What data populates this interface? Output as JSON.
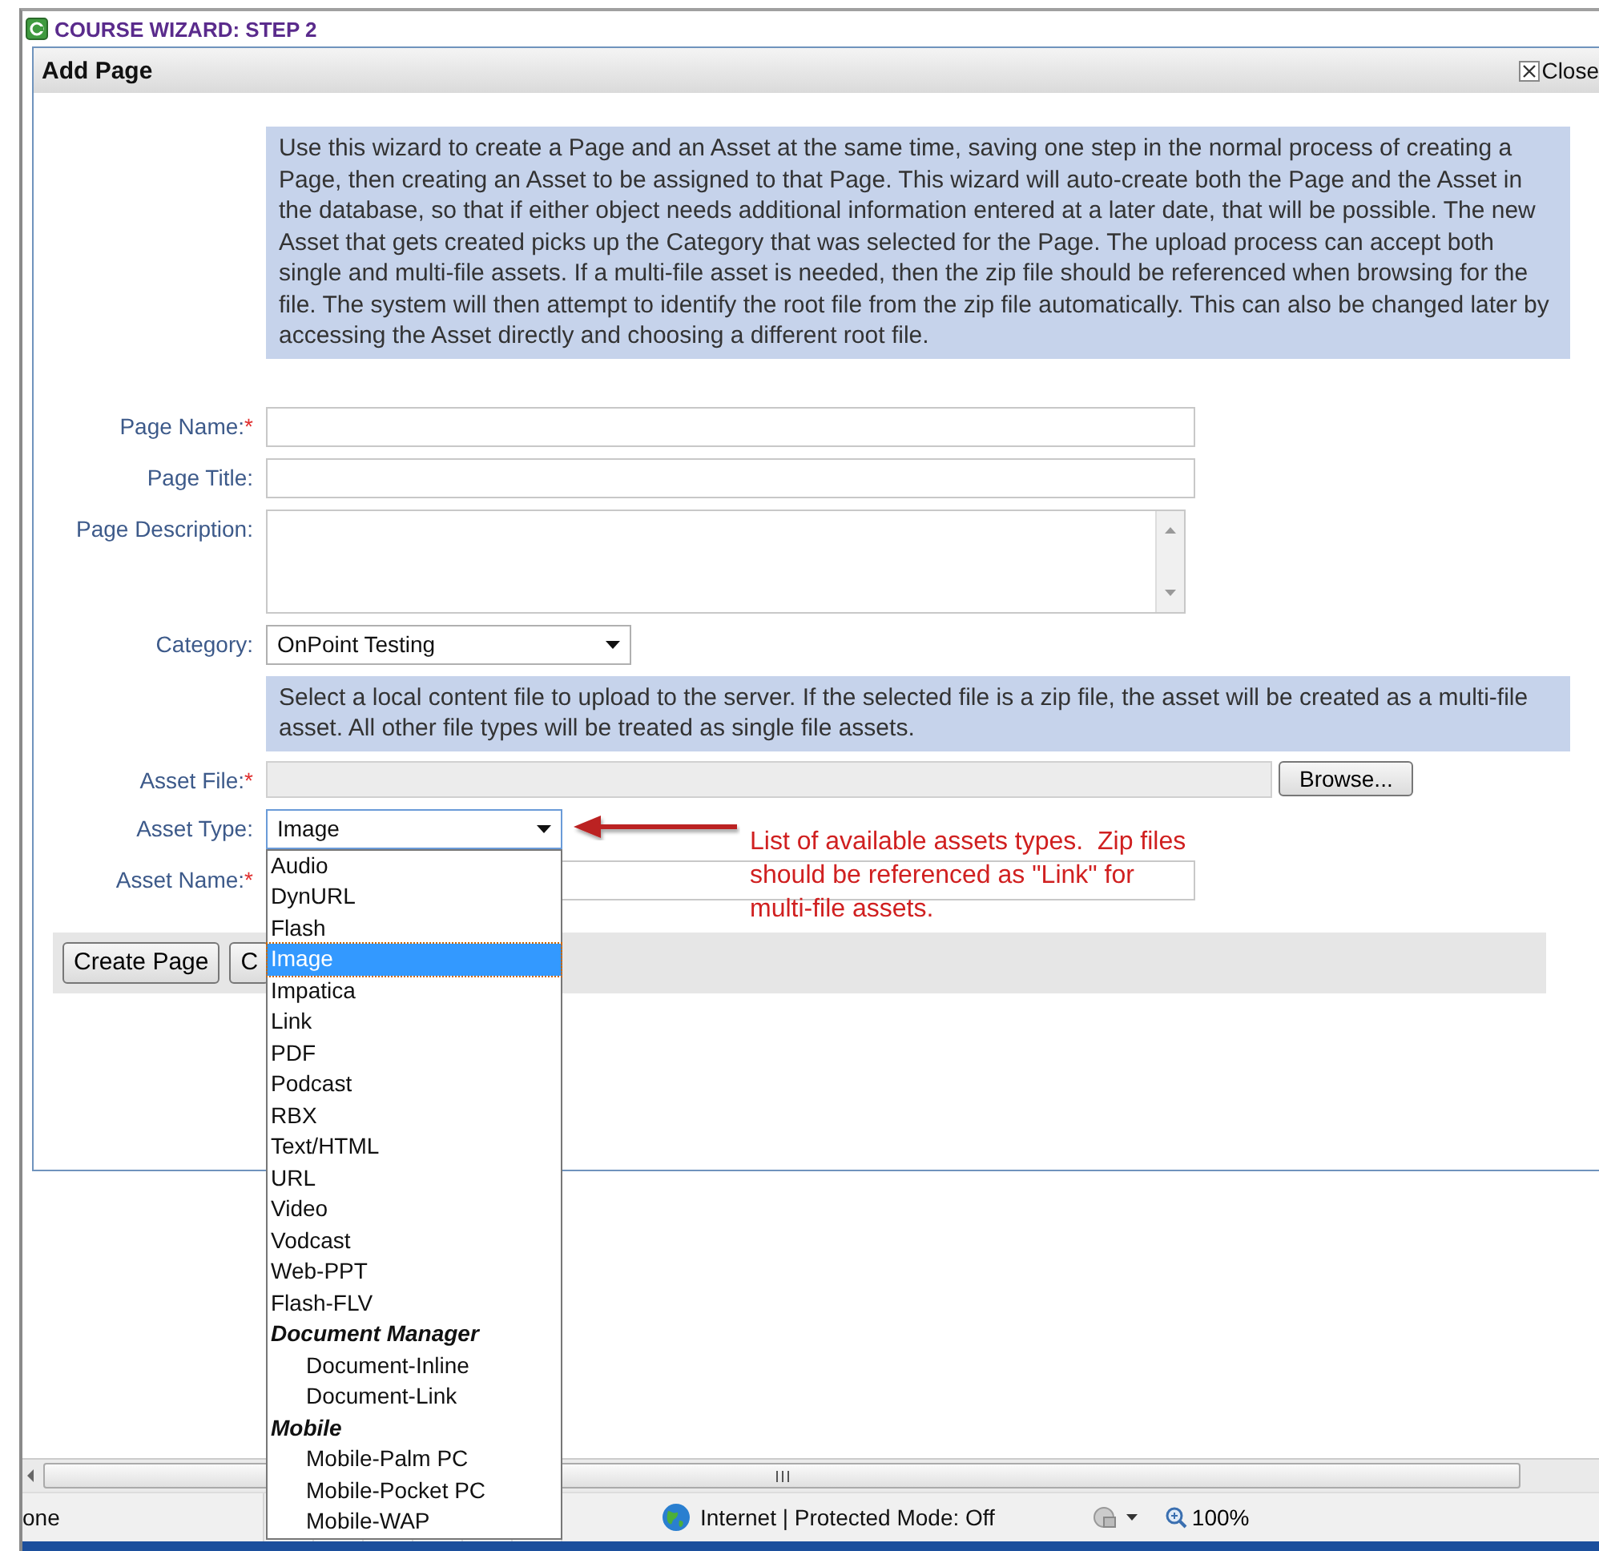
{
  "window": {
    "title": "COURSE WIZARD: STEP 2"
  },
  "dialog": {
    "title": "Add Page",
    "close": "Close"
  },
  "intro": "Use this wizard to create a Page and an Asset at the same time, saving one step in the normal process of creating a Page, then creating an Asset to be assigned to that Page. This wizard will auto-create both the Page and the Asset in the database, so that if either object needs additional information entered at a later date, that will be possible. The new Asset that gets created picks up the Category that was selected for the Page. The upload process can accept both single and multi-file assets. If a multi-file asset is needed, then the zip file should be referenced when browsing for the file. The system will then attempt to identify the root file from the zip file automatically. This can also be changed later by accessing the Asset directly and choosing a different root file.",
  "fields": [
    {
      "kind": "text",
      "label": "Page Name:",
      "marker": "*"
    },
    {
      "kind": "text",
      "label": "Page Title:"
    },
    {
      "kind": "textarea",
      "label": "Page Description:"
    },
    {
      "kind": "select",
      "label": "Category:",
      "value": "OnPoint Testing"
    }
  ],
  "upload_note": "Select a local content file to upload to the server. If the selected file is a zip file, the asset will be created as a multi-file asset. All other file types will be treated as single file assets.",
  "asset_file": {
    "label": "Asset File:",
    "marker": "*",
    "button": "Browse..."
  },
  "asset_type": {
    "label": "Asset Type:",
    "value": "Image",
    "expanded": true,
    "options": [
      {
        "kind": "option",
        "label": "Audio",
        "selected": false
      },
      {
        "kind": "option",
        "label": "DynURL",
        "selected": false
      },
      {
        "kind": "option",
        "label": "Flash",
        "selected": false
      },
      {
        "kind": "option",
        "label": "Image",
        "selected": true
      },
      {
        "kind": "option",
        "label": "Impatica",
        "selected": false
      },
      {
        "kind": "option",
        "label": "Link",
        "selected": false
      },
      {
        "kind": "option",
        "label": "PDF",
        "selected": false
      },
      {
        "kind": "option",
        "label": "Podcast",
        "selected": false
      },
      {
        "kind": "option",
        "label": "RBX",
        "selected": false
      },
      {
        "kind": "option",
        "label": "Text/HTML",
        "selected": false
      },
      {
        "kind": "option",
        "label": "URL",
        "selected": false
      },
      {
        "kind": "option",
        "label": "Video",
        "selected": false
      },
      {
        "kind": "option",
        "label": "Vodcast",
        "selected": false
      },
      {
        "kind": "option",
        "label": "Web-PPT",
        "selected": false
      },
      {
        "kind": "option",
        "label": "Flash-FLV",
        "selected": false
      },
      {
        "kind": "group",
        "label": "Document Manager",
        "children": [
          {
            "kind": "option",
            "label": "Document-Inline",
            "selected": false
          },
          {
            "kind": "option",
            "label": "Document-Link",
            "selected": false
          }
        ]
      },
      {
        "kind": "group",
        "label": "Mobile",
        "children": [
          {
            "kind": "option",
            "label": "Mobile-Palm PC",
            "selected": false
          },
          {
            "kind": "option",
            "label": "Mobile-Pocket PC",
            "selected": false
          },
          {
            "kind": "option",
            "label": "Mobile-WAP",
            "selected": false
          }
        ]
      }
    ]
  },
  "asset_name": {
    "label": "Asset Name:",
    "marker": "*"
  },
  "annotation": {
    "lines": [
      "List of available assets types.  Zip files",
      "should be referenced as \"Link\" for",
      "multi-file assets."
    ]
  },
  "buttons": [
    "Create Page",
    "C"
  ],
  "status_bar": {
    "text": "one",
    "zone": "Internet | Protected Mode: Off",
    "zoom": "100%"
  }
}
